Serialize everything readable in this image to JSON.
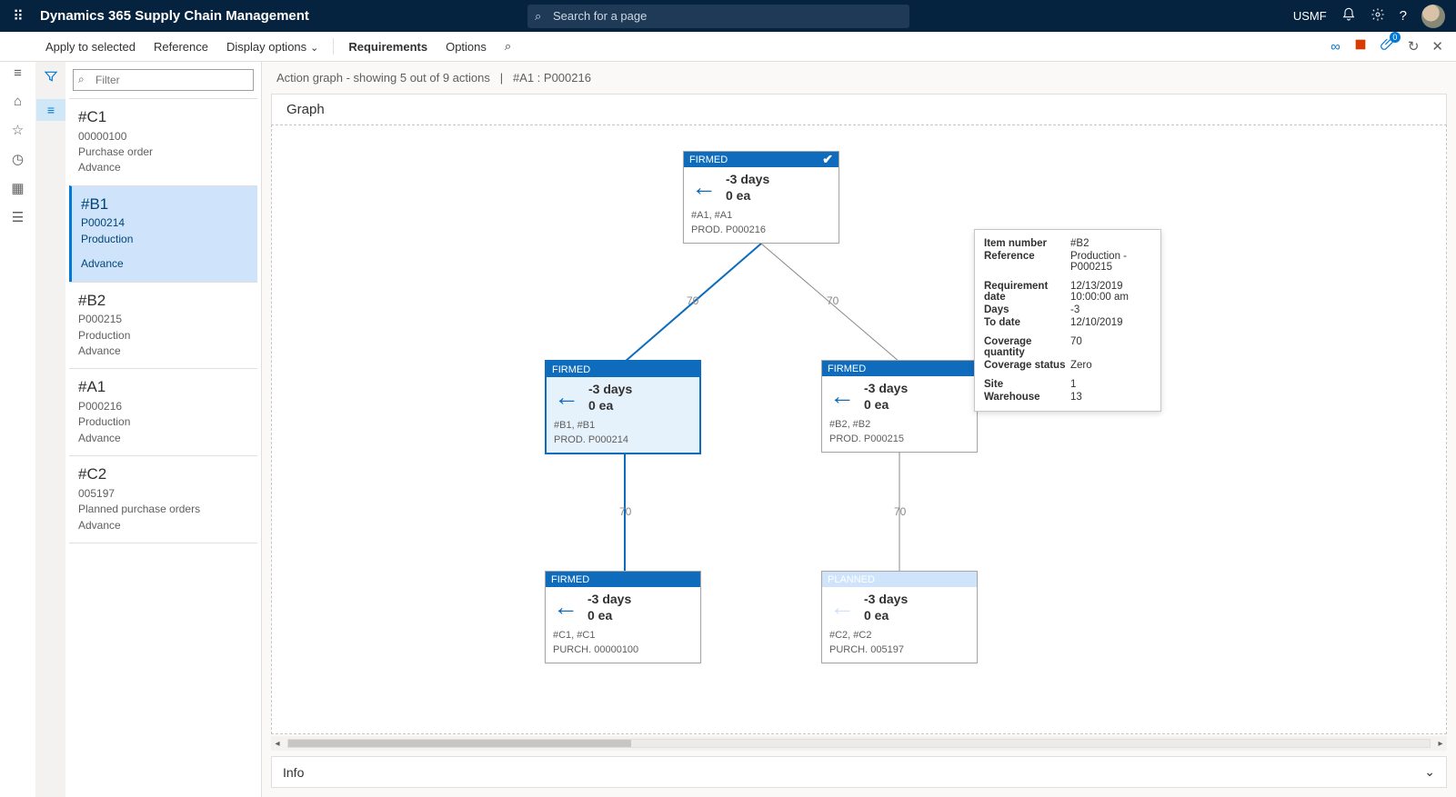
{
  "header": {
    "app_title": "Dynamics 365 Supply Chain Management",
    "search_placeholder": "Search for a page",
    "company": "USMF"
  },
  "cmdbar": {
    "apply": "Apply to selected",
    "reference": "Reference",
    "display": "Display options",
    "requirements": "Requirements",
    "options": "Options"
  },
  "filter": {
    "placeholder": "Filter"
  },
  "list": [
    {
      "id": "#C1",
      "num": "00000100",
      "type": "Purchase order",
      "action": "Advance",
      "selected": false
    },
    {
      "id": "#B1",
      "num": "P000214",
      "type": "Production",
      "action": "Advance",
      "selected": true
    },
    {
      "id": "#B2",
      "num": "P000215",
      "type": "Production",
      "action": "Advance",
      "selected": false
    },
    {
      "id": "#A1",
      "num": "P000216",
      "type": "Production",
      "action": "Advance",
      "selected": false
    },
    {
      "id": "#C2",
      "num": "005197",
      "type": "Planned purchase orders",
      "action": "Advance",
      "selected": false
    }
  ],
  "breadcrumb": {
    "left": "Action graph - showing 5 out of 9 actions",
    "right": "#A1 : P000216"
  },
  "graph_header": "Graph",
  "nodes": {
    "a1": {
      "status": "FIRMED",
      "days": "-3 days",
      "qty": "0 ea",
      "refs": "#A1, #A1",
      "detail": "PROD. P000216",
      "check": true
    },
    "b1": {
      "status": "FIRMED",
      "days": "-3 days",
      "qty": "0 ea",
      "refs": "#B1, #B1",
      "detail": "PROD. P000214"
    },
    "b2": {
      "status": "FIRMED",
      "days": "-3 days",
      "qty": "0 ea",
      "refs": "#B2, #B2",
      "detail": "PROD. P000215"
    },
    "c1": {
      "status": "FIRMED",
      "days": "-3 days",
      "qty": "0 ea",
      "refs": "#C1, #C1",
      "detail": "PURCH. 00000100"
    },
    "c2": {
      "status": "PLANNED",
      "days": "-3 days",
      "qty": "0 ea",
      "refs": "#C2, #C2",
      "detail": "PURCH. 005197"
    }
  },
  "edge_labels": {
    "e1": "70",
    "e2": "70",
    "e3": "70",
    "e4": "70"
  },
  "tooltip": {
    "item_label": "Item number",
    "item_val": "#B2",
    "ref_label": "Reference",
    "ref_val": "Production - P000215",
    "reqdate_label": "Requirement date",
    "reqdate_val": "12/13/2019 10:00:00 am",
    "days_label": "Days",
    "days_val": "-3",
    "todate_label": "To date",
    "todate_val": "12/10/2019",
    "covqty_label": "Coverage quantity",
    "covqty_val": "70",
    "covstat_label": "Coverage status",
    "covstat_val": "Zero",
    "site_label": "Site",
    "site_val": "1",
    "wh_label": "Warehouse",
    "wh_val": "13"
  },
  "info_header": "Info"
}
